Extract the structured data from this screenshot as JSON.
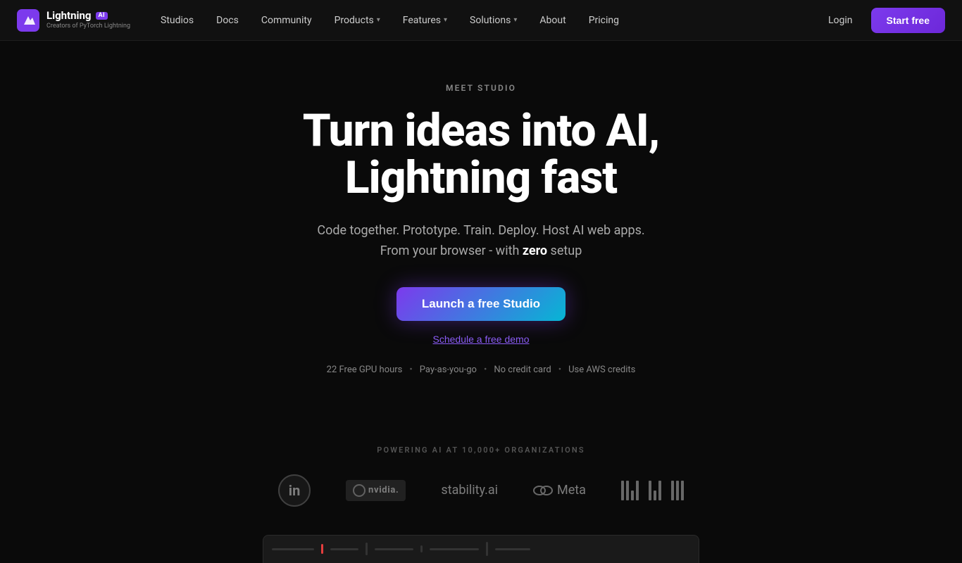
{
  "brand": {
    "name": "Lightning",
    "ai_badge": "AI",
    "subtitle": "Creators of PyTorch Lightning",
    "logo_unicode": "⚡"
  },
  "nav": {
    "links": [
      {
        "label": "Studios",
        "has_dropdown": false
      },
      {
        "label": "Docs",
        "has_dropdown": false
      },
      {
        "label": "Community",
        "has_dropdown": false
      },
      {
        "label": "Products",
        "has_dropdown": true
      },
      {
        "label": "Features",
        "has_dropdown": true
      },
      {
        "label": "Solutions",
        "has_dropdown": true
      },
      {
        "label": "About",
        "has_dropdown": false
      },
      {
        "label": "Pricing",
        "has_dropdown": false
      }
    ],
    "login_label": "Login",
    "start_free_label": "Start free"
  },
  "hero": {
    "eyebrow": "MEET STUDIO",
    "title": "Turn ideas into AI, Lightning fast",
    "subtitle_line1": "Code together. Prototype. Train. Deploy. Host AI web apps.",
    "subtitle_line2_prefix": "From your browser - with ",
    "subtitle_emphasis": "zero",
    "subtitle_line2_suffix": " setup",
    "cta_primary": "Launch a free Studio",
    "cta_secondary": "Schedule a free demo",
    "badge1": "22 Free GPU hours",
    "badge2": "Pay-as-you-go",
    "badge3": "No credit card",
    "badge4": "Use AWS credits"
  },
  "orgs": {
    "title": "POWERING AI AT 10,000+ ORGANIZATIONS",
    "logos": [
      {
        "name": "LinkedIn",
        "type": "linkedin"
      },
      {
        "name": "NVIDIA",
        "type": "nvidia"
      },
      {
        "name": "stability.ai",
        "type": "stability"
      },
      {
        "name": "Meta",
        "type": "meta"
      },
      {
        "name": "MIT",
        "type": "mit"
      }
    ]
  }
}
